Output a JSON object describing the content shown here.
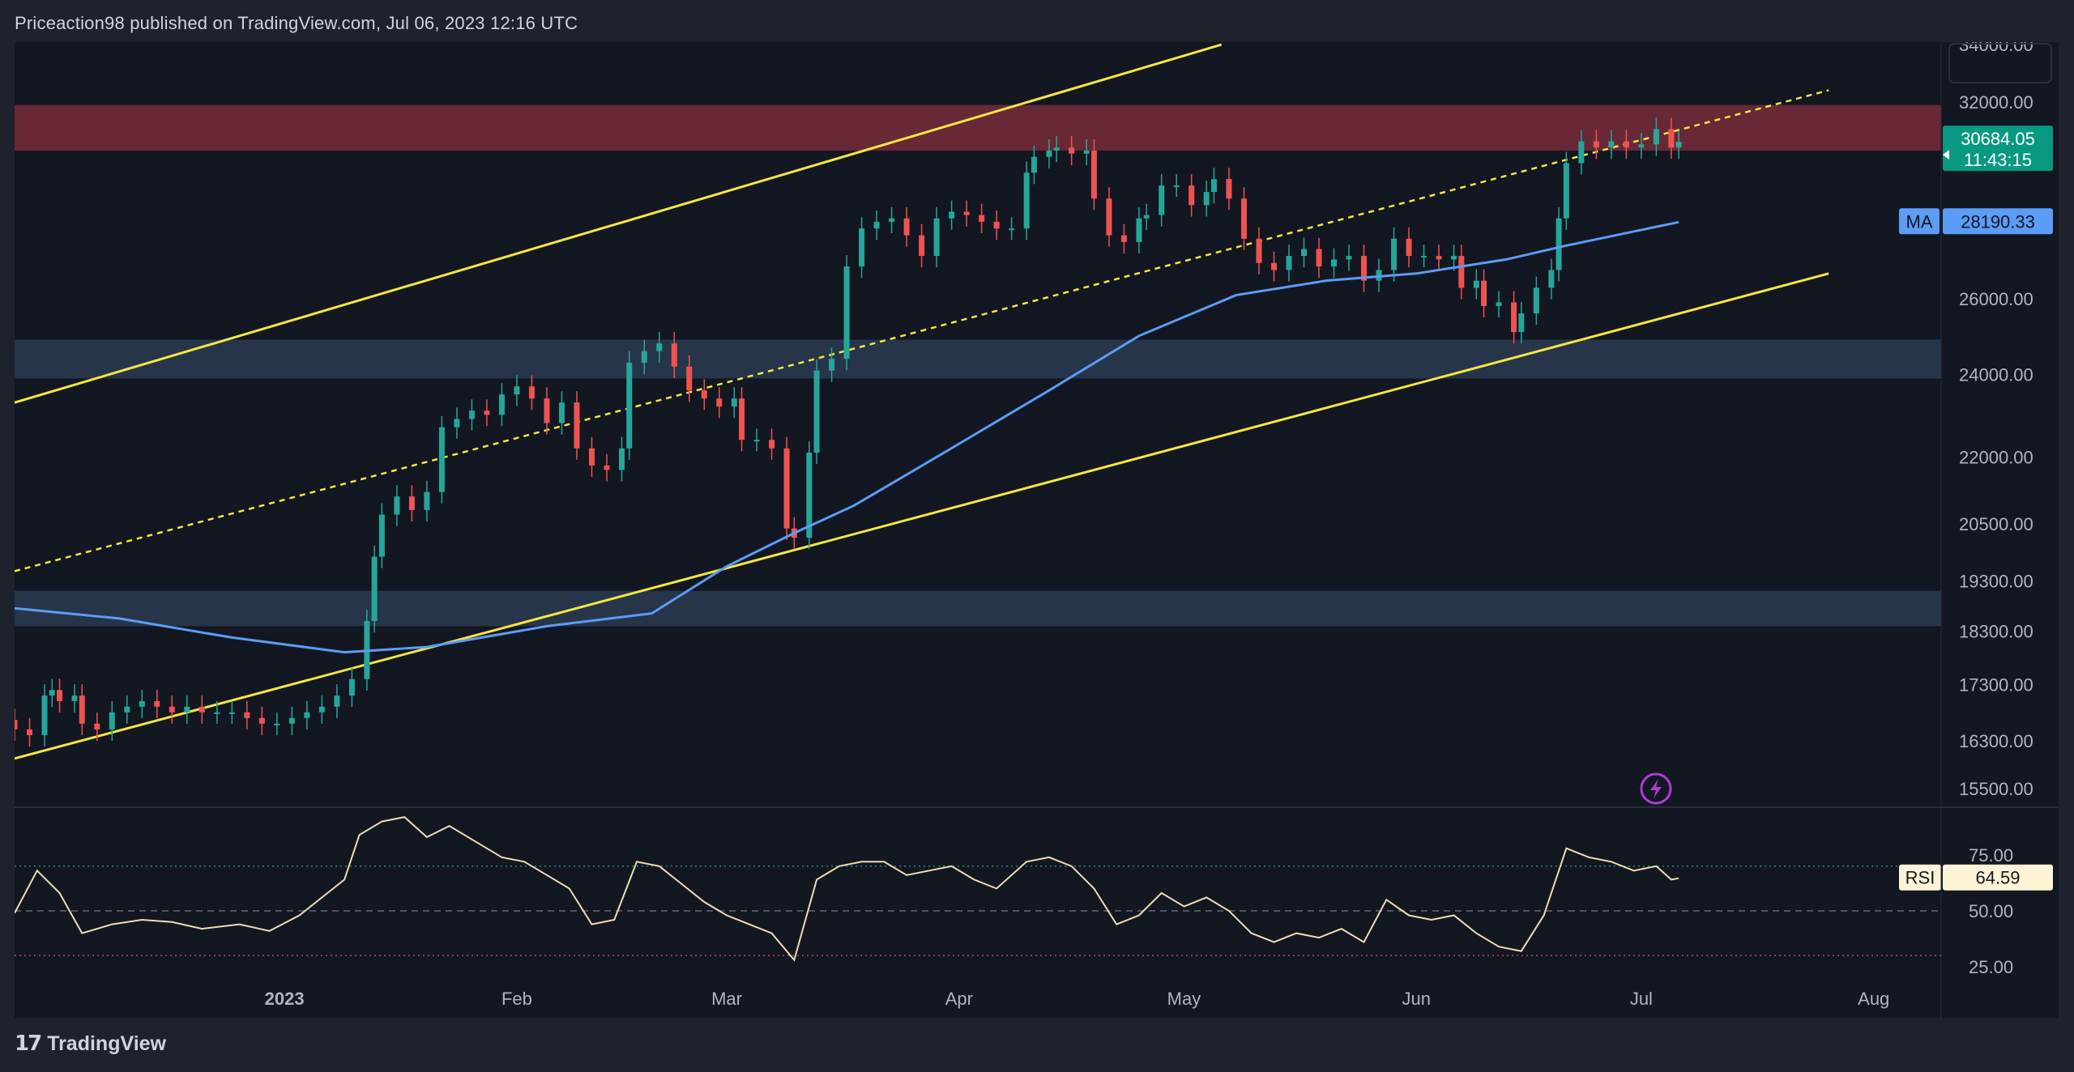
{
  "header": {
    "text": "Priceaction98 published on TradingView.com, Jul 06, 2023 12:16 UTC"
  },
  "footer": {
    "logo_mark": "17",
    "logo_text": "TradingView"
  },
  "colors": {
    "background": "#131722",
    "up": "#26a69a",
    "down": "#ef5350",
    "ma": "#5b9cf6",
    "channel": "#f5e642",
    "resistance_zone": "#7b2c3b",
    "support_zone": "#2f4058",
    "rsi_line": "#f0dcb4",
    "price_badge": "#089981",
    "rsi_badge": "#fff3d6"
  },
  "chart_data": [
    {
      "type": "candlestick",
      "title": "",
      "y_scale": "log",
      "y_ticks": [
        15500,
        16300,
        17300,
        18300,
        19300,
        20500,
        22000,
        24000,
        26000,
        28000,
        30000,
        32000,
        34000
      ],
      "y_tick_labels": [
        "15500.00",
        "16300.00",
        "17300.00",
        "18300.00",
        "19300.00",
        "20500.00",
        "22000.00",
        "24000.00",
        "26000.00",
        "",
        "",
        "32000.00",
        "34000.00"
      ],
      "x_ticks": [
        {
          "label": "2023",
          "date": "2023-01-01"
        },
        {
          "label": "Feb",
          "date": "2023-02-01"
        },
        {
          "label": "Mar",
          "date": "2023-03-01"
        },
        {
          "label": "Apr",
          "date": "2023-04-01"
        },
        {
          "label": "May",
          "date": "2023-05-01"
        },
        {
          "label": "Jun",
          "date": "2023-06-01"
        },
        {
          "label": "Jul",
          "date": "2023-07-01"
        },
        {
          "label": "Aug",
          "date": "2023-08-01"
        }
      ],
      "x_range": [
        "2022-11-26",
        "2023-08-10"
      ],
      "last_price": {
        "value": "30684.05",
        "countdown": "11:43:15"
      },
      "ma": {
        "label": "MA",
        "value": "28190.33"
      },
      "zones": [
        {
          "name": "resistance",
          "from": 30400,
          "to": 31900
        },
        {
          "name": "support",
          "from": 23900,
          "to": 24900
        },
        {
          "name": "support",
          "from": 18400,
          "to": 19100
        }
      ],
      "channel_lines": [
        {
          "style": "solid",
          "points": [
            [
              "2022-11-26",
              23300
            ],
            [
              "2023-05-06",
              34000
            ]
          ]
        },
        {
          "style": "dashed",
          "points": [
            [
              "2022-11-26",
              19500
            ],
            [
              "2023-07-26",
              32400
            ]
          ]
        },
        {
          "style": "solid",
          "points": [
            [
              "2022-11-26",
              16000
            ],
            [
              "2023-07-26",
              26700
            ]
          ]
        }
      ],
      "closes": [
        [
          "2022-11-26",
          16500
        ],
        [
          "2022-11-28",
          16400
        ],
        [
          "2022-11-30",
          17100
        ],
        [
          "2022-12-01",
          17200
        ],
        [
          "2022-12-02",
          17000
        ],
        [
          "2022-12-04",
          17100
        ],
        [
          "2022-12-05",
          16600
        ],
        [
          "2022-12-07",
          16500
        ],
        [
          "2022-12-09",
          16800
        ],
        [
          "2022-12-11",
          16900
        ],
        [
          "2022-12-13",
          17000
        ],
        [
          "2022-12-15",
          16900
        ],
        [
          "2022-12-17",
          16800
        ],
        [
          "2022-12-19",
          16900
        ],
        [
          "2022-12-21",
          16800
        ],
        [
          "2022-12-23",
          16800
        ],
        [
          "2022-12-25",
          16800
        ],
        [
          "2022-12-27",
          16700
        ],
        [
          "2022-12-29",
          16600
        ],
        [
          "2022-12-31",
          16600
        ],
        [
          "2023-01-02",
          16700
        ],
        [
          "2023-01-04",
          16800
        ],
        [
          "2023-01-06",
          16900
        ],
        [
          "2023-01-08",
          17100
        ],
        [
          "2023-01-10",
          17400
        ],
        [
          "2023-01-12",
          18500
        ],
        [
          "2023-01-13",
          19800
        ],
        [
          "2023-01-14",
          20700
        ],
        [
          "2023-01-16",
          21100
        ],
        [
          "2023-01-18",
          20800
        ],
        [
          "2023-01-20",
          21200
        ],
        [
          "2023-01-22",
          22700
        ],
        [
          "2023-01-24",
          22900
        ],
        [
          "2023-01-26",
          23100
        ],
        [
          "2023-01-28",
          23000
        ],
        [
          "2023-01-30",
          23500
        ],
        [
          "2023-02-01",
          23700
        ],
        [
          "2023-02-03",
          23400
        ],
        [
          "2023-02-05",
          22800
        ],
        [
          "2023-02-07",
          23300
        ],
        [
          "2023-02-09",
          22200
        ],
        [
          "2023-02-11",
          21800
        ],
        [
          "2023-02-13",
          21700
        ],
        [
          "2023-02-15",
          22200
        ],
        [
          "2023-02-16",
          24300
        ],
        [
          "2023-02-18",
          24600
        ],
        [
          "2023-02-20",
          24800
        ],
        [
          "2023-02-22",
          24200
        ],
        [
          "2023-02-24",
          23600
        ],
        [
          "2023-02-26",
          23400
        ],
        [
          "2023-02-28",
          23200
        ],
        [
          "2023-03-02",
          23400
        ],
        [
          "2023-03-03",
          22400
        ],
        [
          "2023-03-05",
          22400
        ],
        [
          "2023-03-07",
          22200
        ],
        [
          "2023-03-09",
          20400
        ],
        [
          "2023-03-10",
          20200
        ],
        [
          "2023-03-12",
          22100
        ],
        [
          "2023-03-13",
          24100
        ],
        [
          "2023-03-15",
          24400
        ],
        [
          "2023-03-17",
          26900
        ],
        [
          "2023-03-19",
          28000
        ],
        [
          "2023-03-21",
          28200
        ],
        [
          "2023-03-23",
          28300
        ],
        [
          "2023-03-25",
          27800
        ],
        [
          "2023-03-27",
          27200
        ],
        [
          "2023-03-29",
          28300
        ],
        [
          "2023-03-31",
          28500
        ],
        [
          "2023-04-02",
          28400
        ],
        [
          "2023-04-04",
          28200
        ],
        [
          "2023-04-06",
          28000
        ],
        [
          "2023-04-08",
          28000
        ],
        [
          "2023-04-10",
          29700
        ],
        [
          "2023-04-11",
          30200
        ],
        [
          "2023-04-13",
          30400
        ],
        [
          "2023-04-14",
          30500
        ],
        [
          "2023-04-16",
          30300
        ],
        [
          "2023-04-18",
          30400
        ],
        [
          "2023-04-19",
          28900
        ],
        [
          "2023-04-21",
          27800
        ],
        [
          "2023-04-23",
          27600
        ],
        [
          "2023-04-25",
          28300
        ],
        [
          "2023-04-26",
          28400
        ],
        [
          "2023-04-28",
          29300
        ],
        [
          "2023-04-30",
          29300
        ],
        [
          "2023-05-02",
          28700
        ],
        [
          "2023-05-04",
          29100
        ],
        [
          "2023-05-05",
          29500
        ],
        [
          "2023-05-07",
          28900
        ],
        [
          "2023-05-09",
          27700
        ],
        [
          "2023-05-11",
          27000
        ],
        [
          "2023-05-13",
          26800
        ],
        [
          "2023-05-15",
          27200
        ],
        [
          "2023-05-17",
          27400
        ],
        [
          "2023-05-19",
          26900
        ],
        [
          "2023-05-21",
          27100
        ],
        [
          "2023-05-23",
          27200
        ],
        [
          "2023-05-25",
          26500
        ],
        [
          "2023-05-27",
          26800
        ],
        [
          "2023-05-29",
          27700
        ],
        [
          "2023-05-31",
          27200
        ],
        [
          "2023-06-02",
          27200
        ],
        [
          "2023-06-04",
          27100
        ],
        [
          "2023-06-06",
          27200
        ],
        [
          "2023-06-07",
          26300
        ],
        [
          "2023-06-09",
          26500
        ],
        [
          "2023-06-10",
          25800
        ],
        [
          "2023-06-12",
          25900
        ],
        [
          "2023-06-14",
          25100
        ],
        [
          "2023-06-15",
          25600
        ],
        [
          "2023-06-17",
          26300
        ],
        [
          "2023-06-19",
          26800
        ],
        [
          "2023-06-20",
          28300
        ],
        [
          "2023-06-21",
          30000
        ],
        [
          "2023-06-23",
          30700
        ],
        [
          "2023-06-25",
          30500
        ],
        [
          "2023-06-27",
          30700
        ],
        [
          "2023-06-29",
          30500
        ],
        [
          "2023-07-01",
          30600
        ],
        [
          "2023-07-03",
          31100
        ],
        [
          "2023-07-05",
          30500
        ],
        [
          "2023-07-06",
          30684
        ]
      ],
      "ma_points": [
        [
          "2022-11-26",
          18750
        ],
        [
          "2022-12-10",
          18550
        ],
        [
          "2022-12-25",
          18180
        ],
        [
          "2023-01-09",
          17900
        ],
        [
          "2023-01-20",
          18000
        ],
        [
          "2023-02-05",
          18400
        ],
        [
          "2023-02-19",
          18650
        ],
        [
          "2023-03-01",
          19600
        ],
        [
          "2023-03-10",
          20300
        ],
        [
          "2023-03-18",
          20900
        ],
        [
          "2023-03-30",
          22100
        ],
        [
          "2023-04-13",
          23600
        ],
        [
          "2023-04-25",
          25000
        ],
        [
          "2023-05-08",
          26100
        ],
        [
          "2023-05-20",
          26500
        ],
        [
          "2023-06-01",
          26700
        ],
        [
          "2023-06-13",
          27100
        ],
        [
          "2023-06-21",
          27500
        ],
        [
          "2023-07-06",
          28190
        ]
      ]
    },
    {
      "type": "line",
      "title": "",
      "series_label": "RSI",
      "value": "64.59",
      "y_ticks": [
        25,
        50,
        75
      ],
      "y_tick_labels": [
        "25.00",
        "50.00",
        "75.00"
      ],
      "levels": [
        {
          "value": 70,
          "color": "#26a69a"
        },
        {
          "value": 50,
          "color": "#787b86"
        },
        {
          "value": 30,
          "color": "#ef5350"
        }
      ],
      "points": [
        [
          "2022-11-26",
          49
        ],
        [
          "2022-11-29",
          68
        ],
        [
          "2022-12-02",
          58
        ],
        [
          "2022-12-05",
          40
        ],
        [
          "2022-12-09",
          44
        ],
        [
          "2022-12-13",
          46
        ],
        [
          "2022-12-17",
          45
        ],
        [
          "2022-12-21",
          42
        ],
        [
          "2022-12-26",
          44
        ],
        [
          "2022-12-30",
          41
        ],
        [
          "2023-01-03",
          48
        ],
        [
          "2023-01-06",
          56
        ],
        [
          "2023-01-09",
          64
        ],
        [
          "2023-01-11",
          84
        ],
        [
          "2023-01-14",
          90
        ],
        [
          "2023-01-17",
          92
        ],
        [
          "2023-01-20",
          83
        ],
        [
          "2023-01-23",
          88
        ],
        [
          "2023-01-26",
          82
        ],
        [
          "2023-01-30",
          74
        ],
        [
          "2023-02-02",
          72
        ],
        [
          "2023-02-05",
          66
        ],
        [
          "2023-02-08",
          60
        ],
        [
          "2023-02-11",
          44
        ],
        [
          "2023-02-14",
          46
        ],
        [
          "2023-02-17",
          72
        ],
        [
          "2023-02-20",
          70
        ],
        [
          "2023-02-23",
          62
        ],
        [
          "2023-02-26",
          54
        ],
        [
          "2023-03-01",
          48
        ],
        [
          "2023-03-04",
          44
        ],
        [
          "2023-03-07",
          40
        ],
        [
          "2023-03-10",
          28
        ],
        [
          "2023-03-13",
          64
        ],
        [
          "2023-03-16",
          70
        ],
        [
          "2023-03-19",
          72
        ],
        [
          "2023-03-22",
          72
        ],
        [
          "2023-03-25",
          66
        ],
        [
          "2023-03-28",
          68
        ],
        [
          "2023-03-31",
          70
        ],
        [
          "2023-04-03",
          64
        ],
        [
          "2023-04-06",
          60
        ],
        [
          "2023-04-10",
          72
        ],
        [
          "2023-04-13",
          74
        ],
        [
          "2023-04-16",
          70
        ],
        [
          "2023-04-19",
          60
        ],
        [
          "2023-04-22",
          44
        ],
        [
          "2023-04-25",
          48
        ],
        [
          "2023-04-28",
          58
        ],
        [
          "2023-05-01",
          52
        ],
        [
          "2023-05-04",
          56
        ],
        [
          "2023-05-07",
          50
        ],
        [
          "2023-05-10",
          40
        ],
        [
          "2023-05-13",
          36
        ],
        [
          "2023-05-16",
          40
        ],
        [
          "2023-05-19",
          38
        ],
        [
          "2023-05-22",
          42
        ],
        [
          "2023-05-25",
          36
        ],
        [
          "2023-05-28",
          55
        ],
        [
          "2023-05-31",
          48
        ],
        [
          "2023-06-03",
          46
        ],
        [
          "2023-06-06",
          48
        ],
        [
          "2023-06-09",
          40
        ],
        [
          "2023-06-12",
          34
        ],
        [
          "2023-06-15",
          32
        ],
        [
          "2023-06-18",
          48
        ],
        [
          "2023-06-21",
          78
        ],
        [
          "2023-06-24",
          74
        ],
        [
          "2023-06-27",
          72
        ],
        [
          "2023-06-30",
          68
        ],
        [
          "2023-07-03",
          70
        ],
        [
          "2023-07-05",
          64
        ],
        [
          "2023-07-06",
          64.59
        ]
      ]
    }
  ]
}
